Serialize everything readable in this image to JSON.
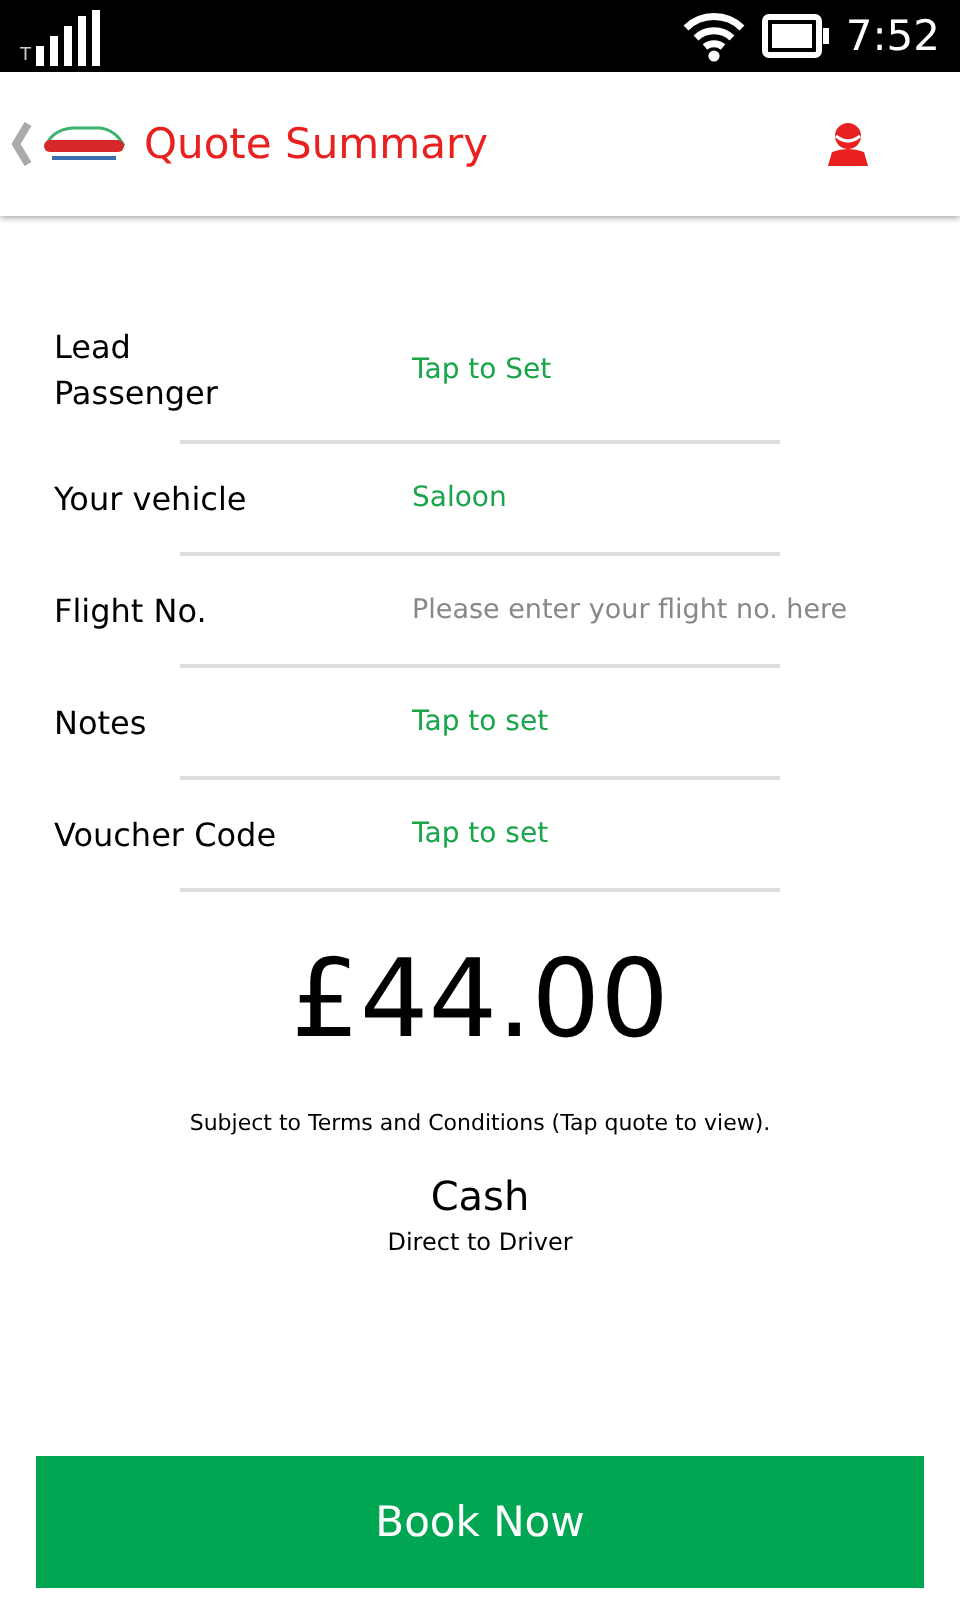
{
  "status_bar": {
    "network": "T",
    "time": "7:52"
  },
  "header": {
    "title": "Quote Summary"
  },
  "rows": [
    {
      "kind": "value",
      "label": "Lead Passenger",
      "value": "Tap to Set"
    },
    {
      "kind": "value",
      "label": "Your vehicle",
      "value": "Saloon"
    },
    {
      "kind": "field",
      "label": "Flight No.",
      "placeholder": "Please enter your flight no. here"
    },
    {
      "kind": "value",
      "label": "Notes",
      "value": "Tap to set"
    },
    {
      "kind": "value",
      "label": "Voucher Code",
      "value": "Tap to set"
    }
  ],
  "price": "£44.00",
  "terms": "Subject to Terms and Conditions (Tap quote to view).",
  "payment": {
    "method": "Cash",
    "detail": "Direct to Driver"
  },
  "buttons": [
    "Book Now"
  ]
}
